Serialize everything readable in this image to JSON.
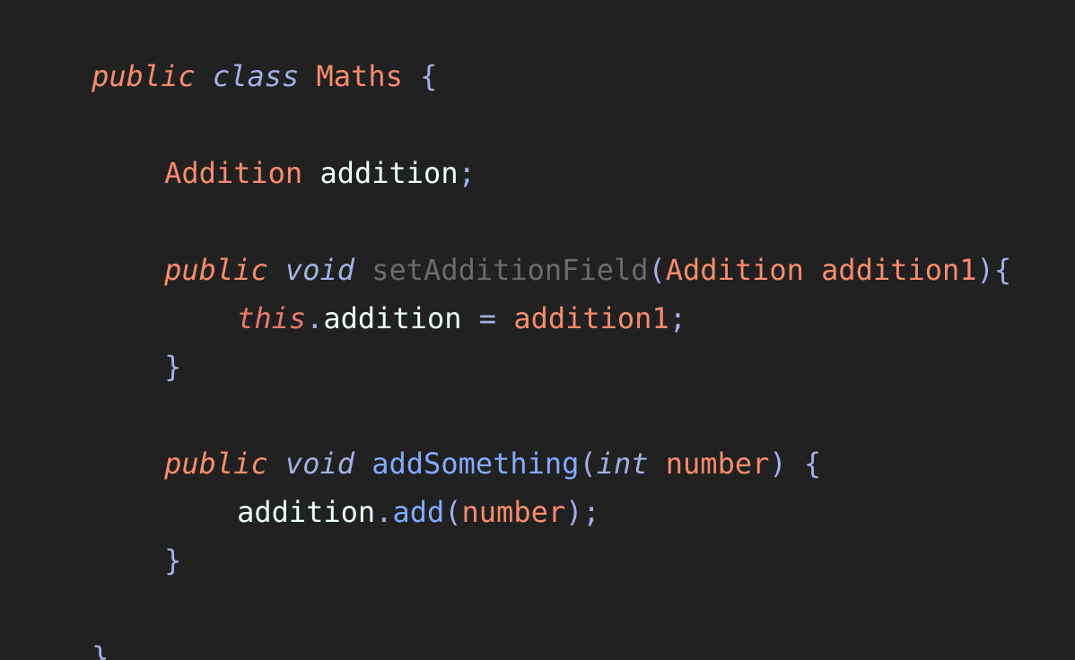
{
  "colors": {
    "background": "#212121",
    "keyword": "#f78c6c",
    "type": "#ffcb6b",
    "class_name": "#f78c6c",
    "punctuation": "#89ddff",
    "brace": "#a3b0e6",
    "method": "#82aaff",
    "unused_method": "#6b6b6b",
    "variable": "#eeffff",
    "parameter": "#f78c6c",
    "this_keyword": "#e77b6a"
  },
  "code": {
    "line1": {
      "kw_public": "public",
      "kw_class": "class",
      "class_name": "Maths",
      "open_brace": "{"
    },
    "line2": {
      "type": "Addition",
      "field": "addition",
      "semicolon": ";"
    },
    "line3": {
      "kw_public": "public",
      "kw_void": "void",
      "method": "setAdditionField",
      "open_paren": "(",
      "param_type": "Addition",
      "param_name": "addition1",
      "close_paren": ")",
      "open_brace": "{"
    },
    "line4": {
      "kw_this": "this",
      "dot": ".",
      "field": "addition",
      "equals": "=",
      "value": "addition1",
      "semicolon": ";"
    },
    "line5": {
      "close_brace": "}"
    },
    "line6": {
      "kw_public": "public",
      "kw_void": "void",
      "method": "addSomething",
      "open_paren": "(",
      "param_type": "int",
      "param_name": "number",
      "close_paren": ")",
      "open_brace": "{"
    },
    "line7": {
      "object": "addition",
      "dot": ".",
      "method": "add",
      "open_paren": "(",
      "arg": "number",
      "close_paren": ")",
      "semicolon": ";"
    },
    "line8": {
      "close_brace": "}"
    },
    "line9": {
      "close_brace": "}"
    }
  }
}
